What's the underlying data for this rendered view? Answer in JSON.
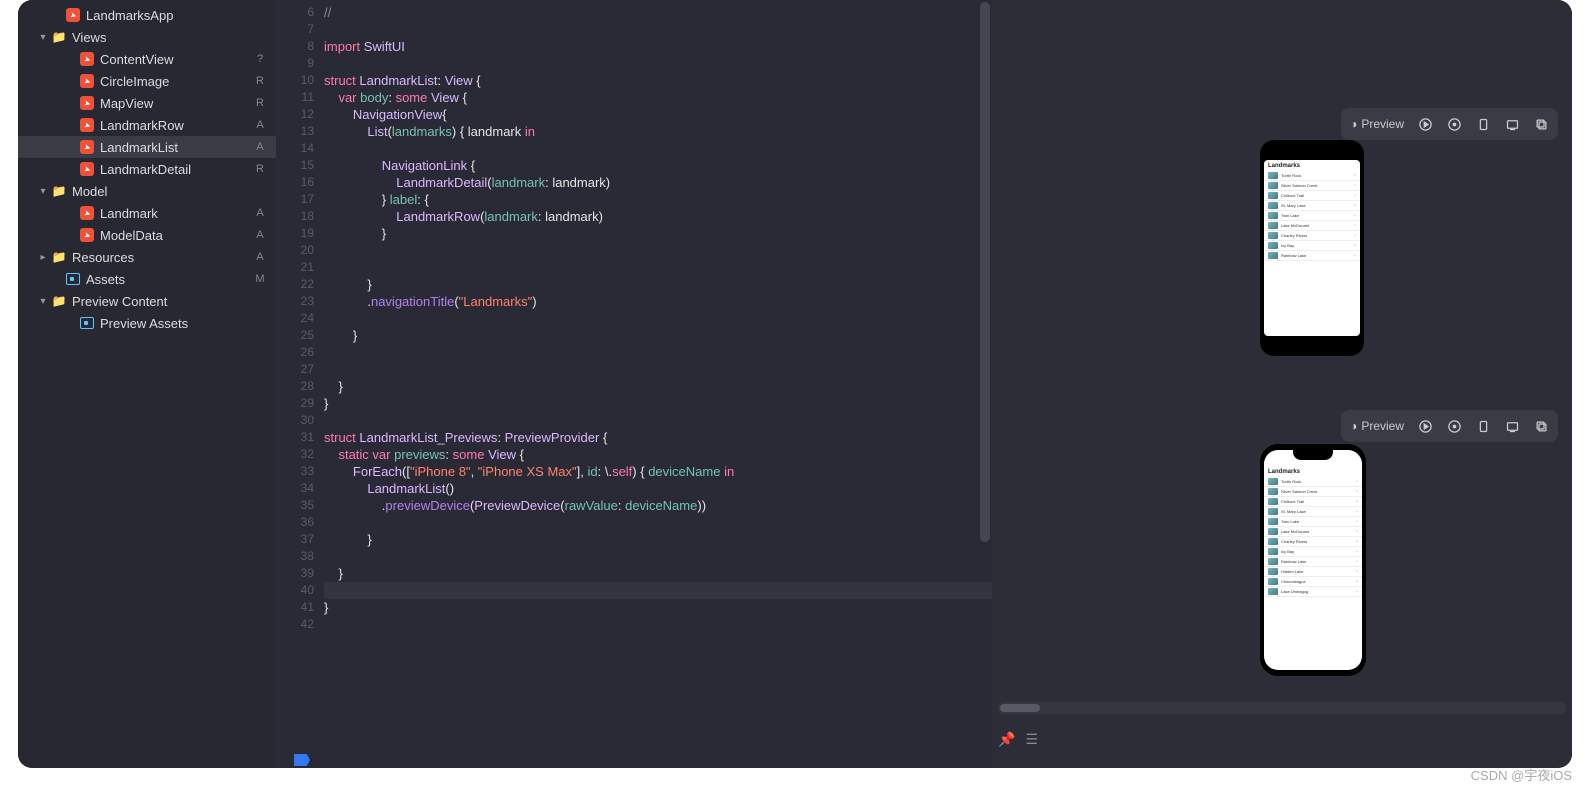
{
  "sidebar": {
    "items": [
      {
        "indent": 32,
        "icon": "swift",
        "label": "LandmarksApp",
        "badge": "",
        "chev": ""
      },
      {
        "indent": 18,
        "icon": "folder",
        "label": "Views",
        "badge": "",
        "chev": "▾"
      },
      {
        "indent": 46,
        "icon": "swift",
        "label": "ContentView",
        "badge": "?",
        "chev": ""
      },
      {
        "indent": 46,
        "icon": "swift",
        "label": "CircleImage",
        "badge": "R",
        "chev": ""
      },
      {
        "indent": 46,
        "icon": "swift",
        "label": "MapView",
        "badge": "R",
        "chev": ""
      },
      {
        "indent": 46,
        "icon": "swift",
        "label": "LandmarkRow",
        "badge": "A",
        "chev": ""
      },
      {
        "indent": 46,
        "icon": "swift",
        "label": "LandmarkList",
        "badge": "A",
        "chev": "",
        "active": true
      },
      {
        "indent": 46,
        "icon": "swift",
        "label": "LandmarkDetail",
        "badge": "R",
        "chev": ""
      },
      {
        "indent": 18,
        "icon": "folder",
        "label": "Model",
        "badge": "",
        "chev": "▾"
      },
      {
        "indent": 46,
        "icon": "swift",
        "label": "Landmark",
        "badge": "A",
        "chev": ""
      },
      {
        "indent": 46,
        "icon": "swift",
        "label": "ModelData",
        "badge": "A",
        "chev": ""
      },
      {
        "indent": 18,
        "icon": "folder",
        "label": "Resources",
        "badge": "A",
        "chev": "▸"
      },
      {
        "indent": 32,
        "icon": "asset",
        "label": "Assets",
        "badge": "M",
        "chev": ""
      },
      {
        "indent": 18,
        "icon": "folder",
        "label": "Preview Content",
        "badge": "",
        "chev": "▾"
      },
      {
        "indent": 46,
        "icon": "asset",
        "label": "Preview Assets",
        "badge": "",
        "chev": ""
      }
    ]
  },
  "code": {
    "first_line": 6,
    "cursor_line": 40,
    "lines": [
      {
        "t": "cmt",
        "s": "//"
      },
      {
        "t": "",
        "s": ""
      },
      {
        "t": "",
        "s": "<kw>import</kw> <ty>SwiftUI</ty>"
      },
      {
        "t": "",
        "s": ""
      },
      {
        "t": "",
        "s": "<kw>struct</kw> <ty>LandmarkList</ty>: <ty>View</ty> {"
      },
      {
        "t": "",
        "s": "    <kw>var</kw> <pr>body</pr>: <kw>some</kw> <ty>View</ty> {"
      },
      {
        "t": "",
        "s": "        <ty>NavigationView</ty>{"
      },
      {
        "t": "",
        "s": "            <ty>List</ty>(<id>landmarks</id>) { landmark <kw>in</kw>"
      },
      {
        "t": "",
        "s": ""
      },
      {
        "t": "",
        "s": "                <ty>NavigationLink</ty> {"
      },
      {
        "t": "",
        "s": "                    <ty>LandmarkDetail</ty>(<id>landmark</id>: landmark)"
      },
      {
        "t": "",
        "s": "                } <id>label</id>: {"
      },
      {
        "t": "",
        "s": "                    <ty>LandmarkRow</ty>(<id>landmark</id>: landmark)"
      },
      {
        "t": "",
        "s": "                }"
      },
      {
        "t": "",
        "s": ""
      },
      {
        "t": "",
        "s": ""
      },
      {
        "t": "",
        "s": "            }"
      },
      {
        "t": "",
        "s": "            .<fn>navigationTitle</fn>(<str>\"Landmarks\"</str>)"
      },
      {
        "t": "",
        "s": ""
      },
      {
        "t": "",
        "s": "        }"
      },
      {
        "t": "",
        "s": ""
      },
      {
        "t": "",
        "s": ""
      },
      {
        "t": "",
        "s": "    }"
      },
      {
        "t": "",
        "s": "}"
      },
      {
        "t": "",
        "s": ""
      },
      {
        "t": "",
        "s": "<kw>struct</kw> <ty>LandmarkList_Previews</ty>: <ty>PreviewProvider</ty> {"
      },
      {
        "t": "",
        "s": "    <kw>static</kw> <kw>var</kw> <pr>previews</pr>: <kw>some</kw> <ty>View</ty> {"
      },
      {
        "t": "",
        "s": "        <ty>ForEach</ty>([<str>\"iPhone 8\"</str>, <str>\"iPhone XS Max\"</str>], <id>id</id>: \\.<self>self</self>) { <id>deviceName</id> <kw>in</kw>"
      },
      {
        "t": "",
        "s": "            <ty>LandmarkList</ty>()"
      },
      {
        "t": "",
        "s": "                .<fn>previewDevice</fn>(<ty>PreviewDevice</ty>(<id>rawValue</id>: <id>deviceName</id>))"
      },
      {
        "t": "",
        "s": ""
      },
      {
        "t": "",
        "s": "            }"
      },
      {
        "t": "",
        "s": ""
      },
      {
        "t": "",
        "s": "    }"
      },
      {
        "t": "cur",
        "s": "    "
      },
      {
        "t": "",
        "s": "}"
      },
      {
        "t": "",
        "s": ""
      }
    ]
  },
  "preview": {
    "toolbar_label": "Preview",
    "screen_title": "Landmarks",
    "landmarks1": [
      "Turtle Rock",
      "Silver Salmon Creek",
      "Chilkoot Trail",
      "St. Mary Lake",
      "Twin Lake",
      "Lake McDonald",
      "Charley Rivers",
      "Icy Bay",
      "Rainbow Lake"
    ],
    "landmarks2": [
      "Turtle Rock",
      "Silver Salmon Creek",
      "Chilkoot Trail",
      "St. Mary Lake",
      "Twin Lake",
      "Lake McDonald",
      "Charley Rivers",
      "Icy Bay",
      "Rainbow Lake",
      "Hidden Lake",
      "Chincoteague",
      "Lake Umbagog"
    ]
  },
  "watermark": "CSDN @宇夜iOS"
}
